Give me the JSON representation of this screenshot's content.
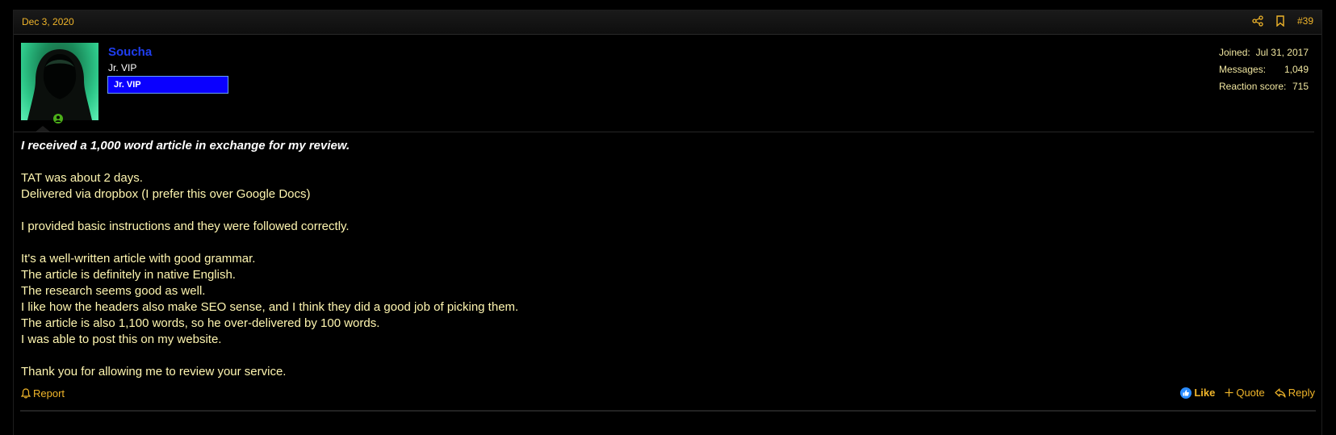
{
  "post": {
    "date": "Dec 3, 2020",
    "number": "#39",
    "icons": {
      "share": "share-icon",
      "bookmark": "bookmark-icon",
      "online": "online-status-icon",
      "report": "bell-icon",
      "like": "like-icon",
      "quote": "plus-icon",
      "reply": "reply-icon"
    }
  },
  "user": {
    "name": "Soucha",
    "title": "Jr. VIP",
    "banner": "Jr. VIP",
    "stats": [
      {
        "label": "Joined:",
        "value": "Jul 31, 2017"
      },
      {
        "label": "Messages:",
        "value": "1,049"
      },
      {
        "label": "Reaction score:",
        "value": "715"
      }
    ]
  },
  "content": {
    "lead": "I received a 1,000 word article in exchange for my review.",
    "lines": [
      "",
      "TAT was about 2 days.",
      "Delivered via dropbox (I prefer this over Google Docs)",
      "",
      "I provided basic instructions and they were followed correctly.",
      "",
      "It's a well-written article with good grammar.",
      "The article is definitely in native English.",
      "The research seems good as well.",
      "I like how the headers also make SEO sense, and I think they did a good job of picking them.",
      "The article is also 1,100 words, so he over-delivered by 100 words.",
      "I was able to post this on my website.",
      "",
      "Thank you for allowing me to review your service."
    ]
  },
  "footer": {
    "report": "Report",
    "like": "Like",
    "quote": "Quote",
    "reply": "Reply"
  },
  "colors": {
    "accent": "#f0b52a",
    "username": "#1f3ef0",
    "banner": "#0a00ff",
    "text": "#fff6b0"
  }
}
